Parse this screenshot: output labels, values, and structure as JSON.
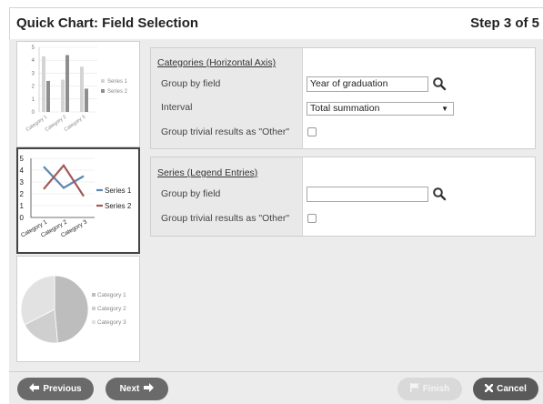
{
  "header": {
    "title": "Quick Chart: Field Selection",
    "step": "Step 3 of 5"
  },
  "thumbnails": {
    "bar": {
      "y_ticks": [
        "5",
        "4",
        "3",
        "2",
        "1",
        "0"
      ],
      "categories": [
        "Category 1",
        "Category 2",
        "Category 3"
      ],
      "series": [
        {
          "name": "Series 1",
          "values": [
            4.3,
            2.5,
            3.5
          ]
        },
        {
          "name": "Series 2",
          "values": [
            2.4,
            4.4,
            1.8
          ]
        }
      ]
    },
    "line": {
      "y_ticks": [
        "5",
        "4",
        "3",
        "2",
        "1",
        "0"
      ],
      "categories": [
        "Category 1",
        "Category 2",
        "Category 3"
      ],
      "series": [
        {
          "name": "Series 1",
          "values": [
            4.3,
            2.5,
            3.5
          ]
        },
        {
          "name": "Series 2",
          "values": [
            2.4,
            4.4,
            1.8
          ]
        }
      ],
      "selected": true
    },
    "pie": {
      "categories": [
        {
          "name": "Category 1",
          "value": 8.2
        },
        {
          "name": "Category 2",
          "value": 3.2
        },
        {
          "name": "Category 3",
          "value": 5.5
        }
      ]
    }
  },
  "categories_section": {
    "title": "Categories (Horizontal Axis)",
    "group_by_label": "Group by field",
    "group_by_value": "Year of graduation",
    "interval_label": "Interval",
    "interval_value": "Total summation",
    "group_trivial_label": "Group trivial results as \"Other\""
  },
  "series_section": {
    "title": "Series (Legend Entries)",
    "group_by_label": "Group by field",
    "group_by_value": "",
    "group_trivial_label": "Group trivial results as \"Other\""
  },
  "footer": {
    "previous_label": "Previous",
    "next_label": "Next",
    "finish_label": "Finish",
    "cancel_label": "Cancel"
  },
  "colors": {
    "series1": "#5b86b0",
    "series2": "#a25858",
    "bar_light": "#d4d4d4",
    "bar_dark": "#8e8e8e",
    "button": "#6a6a6a"
  },
  "icons": {
    "previous": "arrow-left-icon",
    "next": "arrow-right-icon",
    "finish": "flag-icon",
    "cancel": "close-icon",
    "search": "search-icon"
  }
}
